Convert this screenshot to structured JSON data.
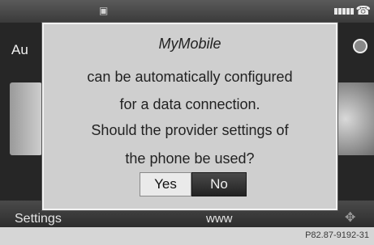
{
  "background": {
    "title_fragment": "Au",
    "bottom_left": "Settings",
    "bottom_center": "www"
  },
  "dialog": {
    "title": "MyMobile",
    "lines": [
      "can be automatically configured",
      "for a data connection.",
      "Should the provider settings of",
      "the phone be used?"
    ],
    "yes_label": "Yes",
    "no_label": "No"
  },
  "caption": "P82.87-9192-31",
  "icons": [
    "sim-icon",
    "signal-strength-icon",
    "phone-icon",
    "globe-icon"
  ]
}
